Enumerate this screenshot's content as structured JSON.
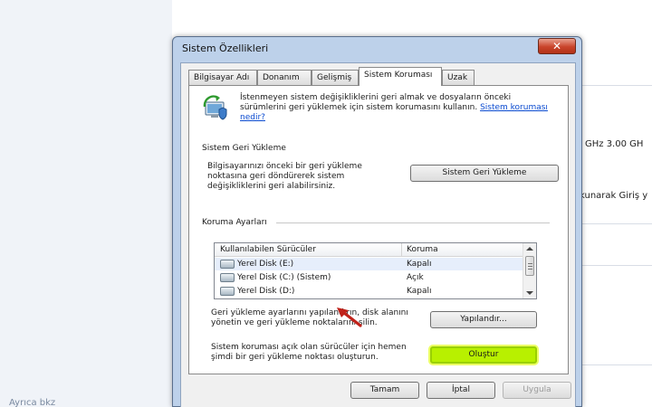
{
  "background": {
    "footer_text": "Ayrıca bkz",
    "spec_text": "GHz   3.00 GH",
    "partial_text": "kunarak Giriş y"
  },
  "dialog": {
    "title": "Sistem Özellikleri",
    "close_symbol": "✕",
    "tabs": [
      {
        "label": "Bilgisayar Adı"
      },
      {
        "label": "Donanım"
      },
      {
        "label": "Gelişmiş"
      },
      {
        "label": "Sistem Koruması",
        "active": true
      },
      {
        "label": "Uzak"
      }
    ],
    "intro_text": "İstenmeyen sistem değişikliklerini geri almak ve dosyaların önceki sürümlerini geri yüklemek için sistem korumasını kullanın.",
    "intro_link": "Sistem koruması nedir?",
    "restore": {
      "heading": "Sistem Geri Yükleme",
      "description": "Bilgisayarınızı önceki bir geri yükleme noktasına geri döndürerek sistem değişikliklerini geri alabilirsiniz.",
      "button": "Sistem Geri Yükleme"
    },
    "protection": {
      "heading": "Koruma Ayarları",
      "col_drives": "Kullanılabilen Sürücüler",
      "col_protection": "Koruma",
      "drives": [
        {
          "name": "Yerel Disk (E:)",
          "status": "Kapalı"
        },
        {
          "name": "Yerel Disk (C:) (Sistem)",
          "status": "Açık"
        },
        {
          "name": "Yerel Disk (D:)",
          "status": "Kapalı"
        }
      ],
      "configure_text": "Geri yükleme ayarlarını yapılandırın, disk alanını yönetin ve geri yükleme noktalarını silin.",
      "configure_button": "Yapılandır...",
      "create_text": "Sistem koruması açık olan sürücüler için hemen şimdi bir geri yükleme noktası oluşturun.",
      "create_button": "Oluştur"
    },
    "buttons": {
      "ok": "Tamam",
      "cancel": "İptal",
      "apply": "Uygula"
    }
  },
  "colors": {
    "highlight_button": "#b8f000",
    "pointer_arrow": "#c0221a",
    "link": "#0b4bd0"
  }
}
